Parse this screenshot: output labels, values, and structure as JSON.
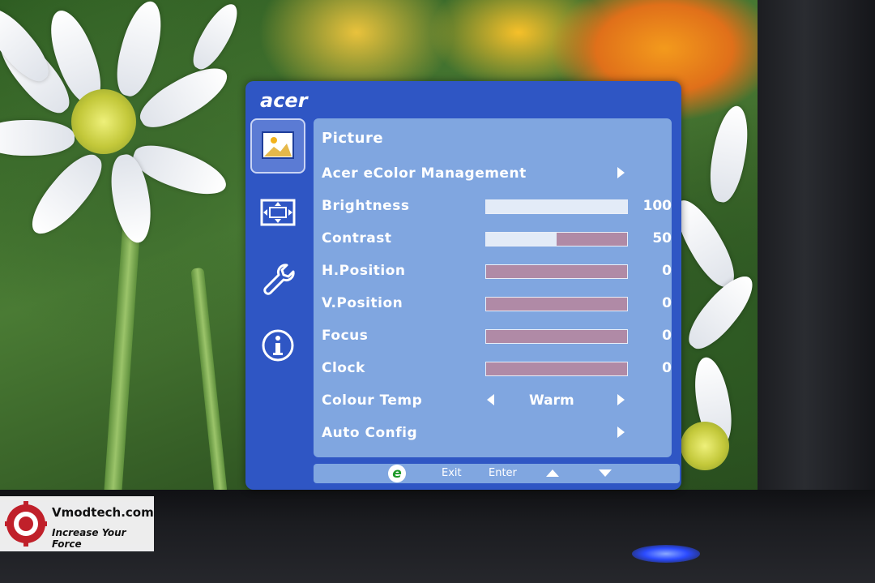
{
  "brand": "acer",
  "menu": {
    "title": "Picture",
    "categories": [
      {
        "icon": "picture-icon",
        "active": true
      },
      {
        "icon": "position-icon",
        "active": false
      },
      {
        "icon": "wrench-icon",
        "active": false
      },
      {
        "icon": "info-icon",
        "active": false
      }
    ],
    "items": [
      {
        "label": "Acer eColor Management",
        "kind": "submenu"
      },
      {
        "label": "Brightness",
        "kind": "slider",
        "value": "100",
        "level": 100
      },
      {
        "label": "Contrast",
        "kind": "slider",
        "value": "50",
        "level": 50
      },
      {
        "label": "H.Position",
        "kind": "slider",
        "value": "0",
        "level": 0
      },
      {
        "label": "V.Position",
        "kind": "slider",
        "value": "0",
        "level": 0
      },
      {
        "label": "Focus",
        "kind": "slider",
        "value": "0",
        "level": 0
      },
      {
        "label": "Clock",
        "kind": "slider",
        "value": "0",
        "level": 0
      },
      {
        "label": "Colour Temp",
        "kind": "selector",
        "value": "Warm"
      },
      {
        "label": "Auto Config",
        "kind": "submenu"
      }
    ]
  },
  "footer": {
    "eco_label": "e",
    "exit": "Exit",
    "enter": "Enter"
  },
  "watermark": {
    "site": "Vmodtech.com",
    "tagline": "Increase Your Force"
  },
  "colors": {
    "osd_frame": "#2f56c4",
    "osd_panel": "#80a6e0",
    "bar_empty": "#b08aa6",
    "bar_fill": "#e3ebf7"
  }
}
